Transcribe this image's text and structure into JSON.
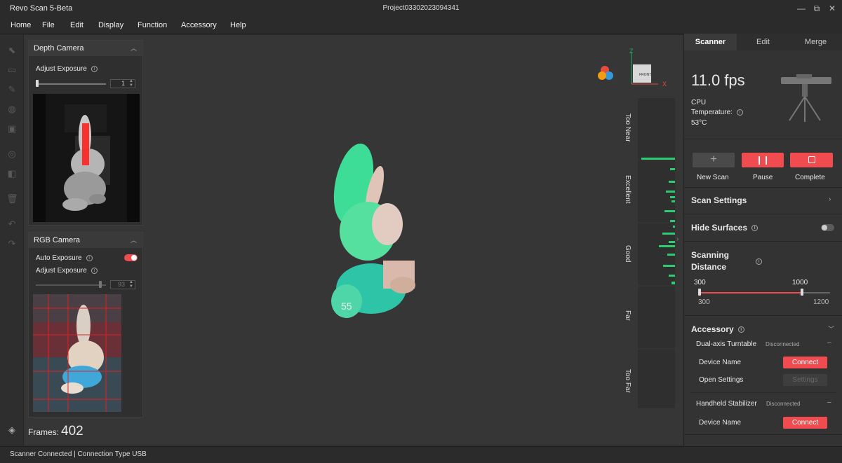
{
  "window": {
    "app_title": "Revo Scan 5-Beta",
    "project_title": "Project03302023094341",
    "minimize": "—",
    "restore": "⧉",
    "close": "✕"
  },
  "menu": [
    "Home",
    "File",
    "Edit",
    "Display",
    "Function",
    "Accessory",
    "Help"
  ],
  "depth_camera": {
    "title": "Depth Camera",
    "exposure_label": "Adjust Exposure",
    "exposure_value": "1"
  },
  "rgb_camera": {
    "title": "RGB Camera",
    "auto_exposure_label": "Auto Exposure",
    "auto_exposure_on": true,
    "exposure_label": "Adjust Exposure",
    "exposure_value": "93"
  },
  "viewport": {
    "frames_label": "Frames:",
    "frames_value": "402",
    "view_cube_label": "FRONT",
    "axis_z": "Z",
    "axis_x": "X"
  },
  "quality_bar": {
    "labels": [
      "Too Near",
      "Excellent",
      "Good",
      "Far",
      "Too Far"
    ]
  },
  "tabs": [
    "Scanner",
    "Edit",
    "Merge"
  ],
  "scanner": {
    "fps": "11.0 fps",
    "cpu_label": "CPU",
    "temperature_label": "Temperature:",
    "temperature_value": "53°C",
    "new_scan": "New Scan",
    "pause": "Pause",
    "complete": "Complete",
    "scan_settings": "Scan Settings",
    "hide_surfaces": "Hide Surfaces",
    "hide_surfaces_on": false,
    "scanning_distance_line1": "Scanning",
    "scanning_distance_line2": "Distance",
    "distance_low": "300",
    "distance_high": "1000",
    "distance_min": "300",
    "distance_max": "1200",
    "accessory": "Accessory",
    "turntable_label": "Dual-axis Turntable",
    "turntable_status": "Disconnected",
    "device_name": "Device Name",
    "connect": "Connect",
    "open_settings": "Open Settings",
    "settings": "Settings",
    "stabilizer_label": "Handheld Stabilizer",
    "stabilizer_status": "Disconnected",
    "device_name_2": "Device Name",
    "connect_2": "Connect"
  },
  "status_bar": "Scanner Connected | Connection Type USB",
  "colors": {
    "accent_red": "#f04b4f",
    "scan_green": "#3ddc97",
    "quality_green": "#2ecc71"
  }
}
